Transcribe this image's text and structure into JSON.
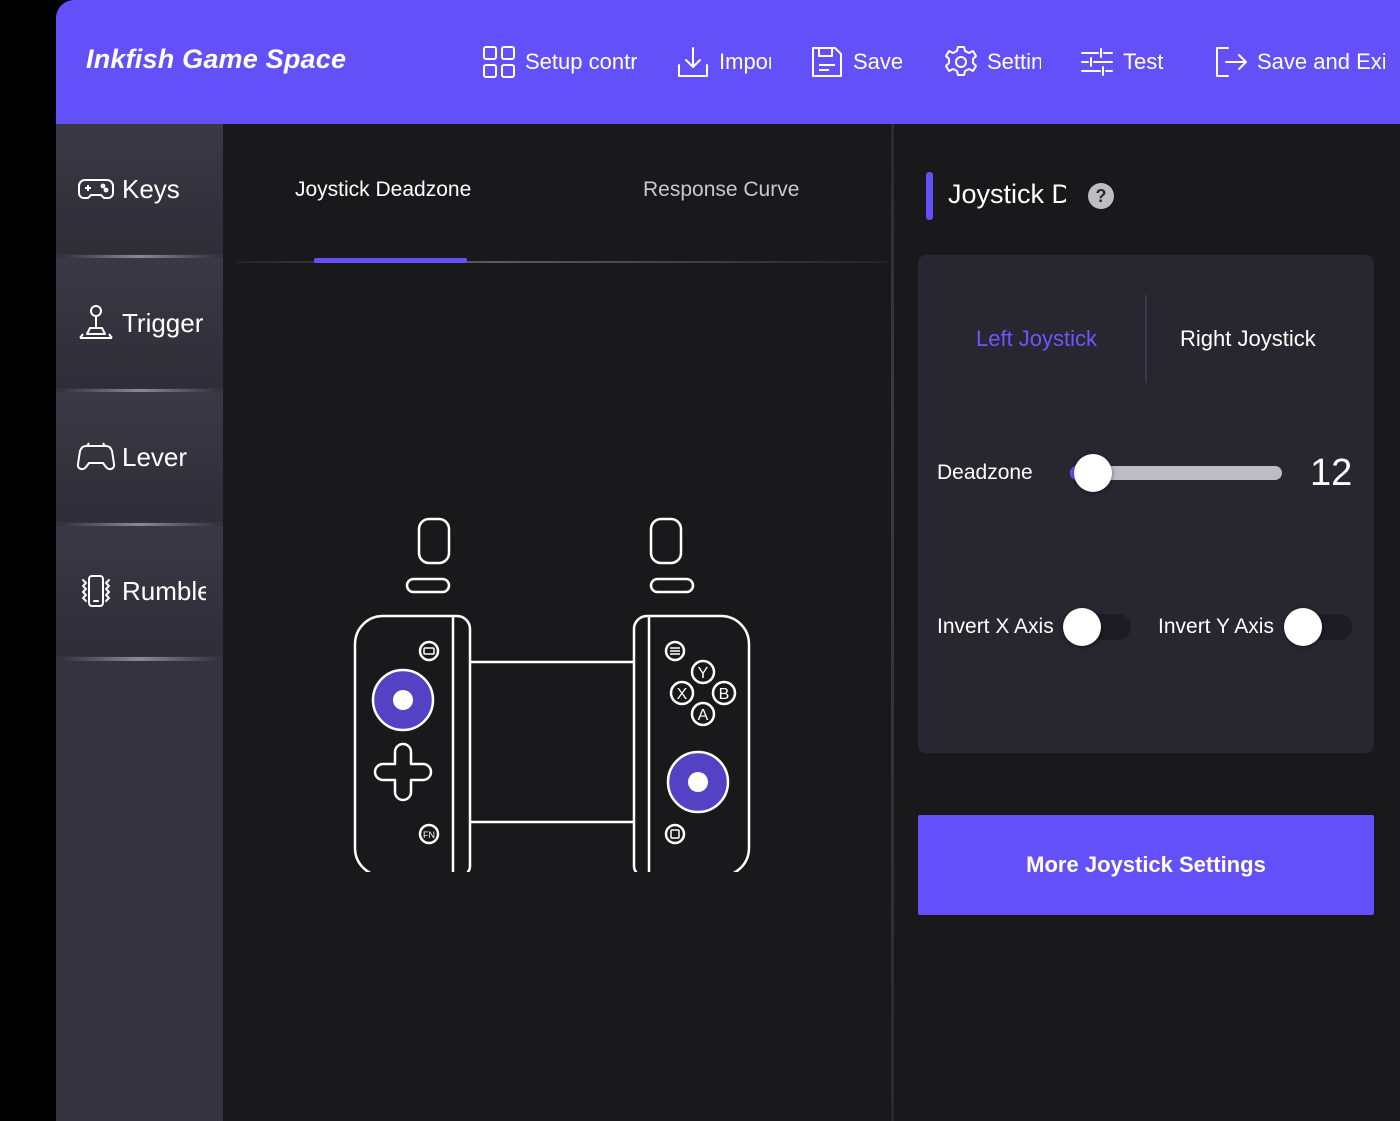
{
  "app": {
    "brand": "Inkfish Game Space"
  },
  "toolbar": [
    {
      "id": "setup",
      "label": "Setup controls",
      "icon": "grid-icon"
    },
    {
      "id": "import",
      "label": "Import",
      "icon": "download-icon"
    },
    {
      "id": "save",
      "label": "Save",
      "icon": "save-icon"
    },
    {
      "id": "settings",
      "label": "Settings",
      "icon": "gear-icon"
    },
    {
      "id": "test",
      "label": "Test",
      "icon": "sliders-icon"
    },
    {
      "id": "save_exit",
      "label": "Save and Exit",
      "icon": "exit-icon"
    }
  ],
  "sidebar": {
    "items": [
      {
        "label": "Keys",
        "icon": "gamepad-icon"
      },
      {
        "label": "Trigger",
        "icon": "joystick-icon"
      },
      {
        "label": "Lever",
        "icon": "controller-icon"
      },
      {
        "label": "Rumble",
        "icon": "vibrate-icon"
      }
    ]
  },
  "center": {
    "tabs": [
      {
        "label": "Joystick Deadzone",
        "active": true
      },
      {
        "label": "Response Curve",
        "active": false
      }
    ]
  },
  "panel": {
    "title": "Joystick Deadzone",
    "help": "?",
    "joystick_tabs": [
      {
        "label": "Left Joystick",
        "active": true
      },
      {
        "label": "Right Joystick",
        "active": false
      }
    ],
    "deadzone": {
      "label": "Deadzone",
      "value": "12",
      "fraction": 0.11
    },
    "invert_x": {
      "label": "Invert X Axis",
      "on": false
    },
    "invert_y": {
      "label": "Invert Y Axis",
      "on": false
    },
    "more_button": "More Joystick Settings"
  },
  "colors": {
    "accent": "#6350f8",
    "active_tab_text": "#6a58ff",
    "background": "#19191b",
    "card": "#282730",
    "sidebar": "#35333e"
  }
}
